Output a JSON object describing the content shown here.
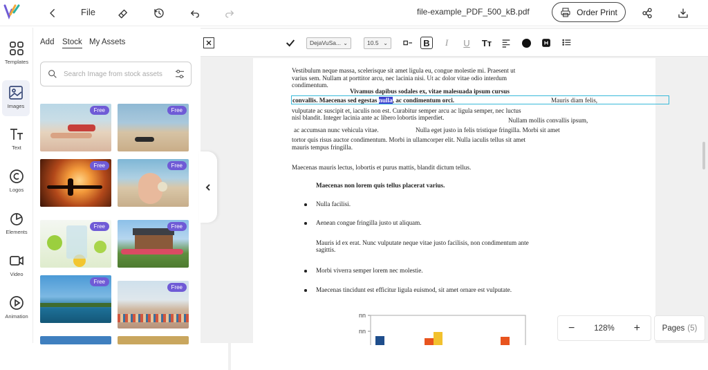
{
  "topbar": {
    "file_label": "File",
    "doc_title": "file-example_PDF_500_kB.pdf",
    "order_print_label": "Order Print"
  },
  "leftnav": {
    "items": [
      {
        "label": "Templates",
        "icon": "templates-icon"
      },
      {
        "label": "Images",
        "icon": "images-icon",
        "active": true
      },
      {
        "label": "Text",
        "icon": "text-icon"
      },
      {
        "label": "Logos",
        "icon": "logos-icon"
      },
      {
        "label": "Elements",
        "icon": "elements-icon"
      },
      {
        "label": "Video",
        "icon": "video-icon"
      },
      {
        "label": "Animation",
        "icon": "animation-icon"
      }
    ]
  },
  "panel": {
    "tabs": [
      "Add",
      "Stock",
      "My Assets"
    ],
    "active_tab": "Stock",
    "search_placeholder": "Search Image from stock assets",
    "badge_label": "Free",
    "accent_color": "#6f5bd6"
  },
  "formatbar": {
    "font_family": "DejaVuSa...",
    "font_size": "10.5",
    "bold_label": "B",
    "italic_label": "I",
    "underline_label": "U",
    "case_label": "Tт"
  },
  "document": {
    "line1": "Vestibulum neque massa, scelerisque sit amet ligula eu, congue molestie mi. Praesent ut",
    "line2": "varius sem. Nullam at porttitor arcu, nec lacinia nisi. Ut ac dolor vitae odio interdum",
    "line3": "condimentum.",
    "line4": "Vivamus dapibus sodales ex, vitae malesuada ipsum cursus",
    "line5a": "convallis. Maecenas sed egestas ",
    "line5hl": "nulla",
    "line5b": ", ac condimentum orci.",
    "line5c": "Mauris diam felis,",
    "line6": "vulputate ac suscipit et, iaculis non est. Curabitur semper arcu ac ligula semper, nec luctus",
    "line7": "nisl blandit. Integer lacinia ante ac libero lobortis imperdiet.",
    "line7b": "Nullam mollis convallis ipsum,",
    "line8a": "ac accumsan nunc vehicula vitae.",
    "line8b": "Nulla eget justo in felis tristique fringilla. Morbi sit amet",
    "line9": "tortor quis risus auctor condimentum. Morbi in ullamcorper elit. Nulla iaculis tellus sit amet",
    "line10": "mauris tempus fringilla.",
    "para2": "Maecenas mauris lectus, lobortis et purus mattis, blandit dictum tellus.",
    "heading": "Maecenas non lorem quis tellus placerat varius.",
    "bullet1": "Nulla facilisi.",
    "bullet2": "Aenean congue fringilla justo ut aliquam.",
    "subpara1": "Mauris id ex erat. Nunc vulputate neque vitae justo facilisis, non condimentum ante",
    "subpara2": "sagittis.",
    "bullet3": "Morbi viverra semper lorem nec molestie.",
    "bullet4": "Maecenas tincidunt est efficitur ligula euismod, sit amet ornare est vulputate."
  },
  "chart_data": {
    "type": "bar",
    "tick_labels": [
      "nn",
      "nn"
    ],
    "series_colors": [
      "#1f4e8c",
      "#e8541e",
      "#f2c12e"
    ]
  },
  "zoom": {
    "minus": "−",
    "value": "128%",
    "plus": "+"
  },
  "pages": {
    "label": "Pages",
    "count": "(5)"
  }
}
